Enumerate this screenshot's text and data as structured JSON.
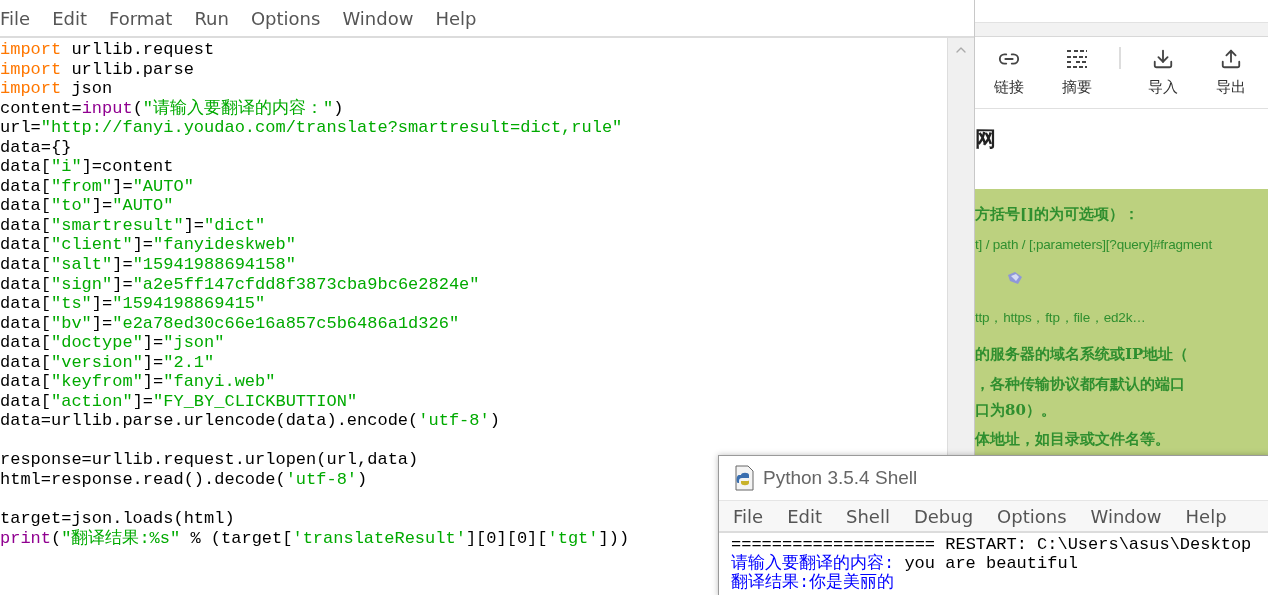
{
  "editor": {
    "menu": [
      "File",
      "Edit",
      "Format",
      "Run",
      "Options",
      "Window",
      "Help"
    ],
    "blocks": [
      [
        [
          {
            "kind": "keyword",
            "text": "import"
          },
          {
            "kind": "plain",
            "text": " urllib.request"
          }
        ],
        [
          {
            "kind": "keyword",
            "text": "import"
          },
          {
            "kind": "plain",
            "text": " urllib.parse"
          }
        ],
        [
          {
            "kind": "keyword",
            "text": "import"
          },
          {
            "kind": "plain",
            "text": " json"
          }
        ],
        [
          {
            "kind": "plain",
            "text": "content="
          },
          {
            "kind": "builtin",
            "text": "input"
          },
          {
            "kind": "plain",
            "text": "("
          },
          {
            "kind": "string",
            "text": "\"请输入要翻译的内容：\""
          },
          {
            "kind": "plain",
            "text": ")"
          }
        ],
        [
          {
            "kind": "plain",
            "text": "url="
          },
          {
            "kind": "string",
            "text": "\"http://fanyi.youdao.com/translate?smartresult=dict,rule\""
          }
        ],
        [
          {
            "kind": "plain",
            "text": "data={}"
          }
        ],
        [
          {
            "kind": "plain",
            "text": "data["
          },
          {
            "kind": "string",
            "text": "\"i\""
          },
          {
            "kind": "plain",
            "text": "]=content"
          }
        ],
        [
          {
            "kind": "plain",
            "text": "data["
          },
          {
            "kind": "string",
            "text": "\"from\""
          },
          {
            "kind": "plain",
            "text": "]="
          },
          {
            "kind": "string",
            "text": "\"AUTO\""
          }
        ],
        [
          {
            "kind": "plain",
            "text": "data["
          },
          {
            "kind": "string",
            "text": "\"to\""
          },
          {
            "kind": "plain",
            "text": "]="
          },
          {
            "kind": "string",
            "text": "\"AUTO\""
          }
        ],
        [
          {
            "kind": "plain",
            "text": "data["
          },
          {
            "kind": "string",
            "text": "\"smartresult\""
          },
          {
            "kind": "plain",
            "text": "]="
          },
          {
            "kind": "string",
            "text": "\"dict\""
          }
        ],
        [
          {
            "kind": "plain",
            "text": "data["
          },
          {
            "kind": "string",
            "text": "\"client\""
          },
          {
            "kind": "plain",
            "text": "]="
          },
          {
            "kind": "string",
            "text": "\"fanyideskweb\""
          }
        ],
        [
          {
            "kind": "plain",
            "text": "data["
          },
          {
            "kind": "string",
            "text": "\"salt\""
          },
          {
            "kind": "plain",
            "text": "]="
          },
          {
            "kind": "string",
            "text": "\"15941988694158\""
          }
        ],
        [
          {
            "kind": "plain",
            "text": "data["
          },
          {
            "kind": "string",
            "text": "\"sign\""
          },
          {
            "kind": "plain",
            "text": "]="
          },
          {
            "kind": "string",
            "text": "\"a2e5ff147cfdd8f3873cba9bc6e2824e\""
          }
        ],
        [
          {
            "kind": "plain",
            "text": "data["
          },
          {
            "kind": "string",
            "text": "\"ts\""
          },
          {
            "kind": "plain",
            "text": "]="
          },
          {
            "kind": "string",
            "text": "\"1594198869415\""
          }
        ],
        [
          {
            "kind": "plain",
            "text": "data["
          },
          {
            "kind": "string",
            "text": "\"bv\""
          },
          {
            "kind": "plain",
            "text": "]="
          },
          {
            "kind": "string",
            "text": "\"e2a78ed30c66e16a857c5b6486a1d326\""
          }
        ],
        [
          {
            "kind": "plain",
            "text": "data["
          },
          {
            "kind": "string",
            "text": "\"doctype\""
          },
          {
            "kind": "plain",
            "text": "]="
          },
          {
            "kind": "string",
            "text": "\"json\""
          }
        ],
        [
          {
            "kind": "plain",
            "text": "data["
          },
          {
            "kind": "string",
            "text": "\"version\""
          },
          {
            "kind": "plain",
            "text": "]="
          },
          {
            "kind": "string",
            "text": "\"2.1\""
          }
        ],
        [
          {
            "kind": "plain",
            "text": "data["
          },
          {
            "kind": "string",
            "text": "\"keyfrom\""
          },
          {
            "kind": "plain",
            "text": "]="
          },
          {
            "kind": "string",
            "text": "\"fanyi.web\""
          }
        ],
        [
          {
            "kind": "plain",
            "text": "data["
          },
          {
            "kind": "string",
            "text": "\"action\""
          },
          {
            "kind": "plain",
            "text": "]="
          },
          {
            "kind": "string",
            "text": "\"FY_BY_CLICKBUTTION\""
          }
        ],
        [
          {
            "kind": "plain",
            "text": "data=urllib.parse.urlencode(data).encode("
          },
          {
            "kind": "string",
            "text": "'utf-8'"
          },
          {
            "kind": "plain",
            "text": ")"
          }
        ]
      ],
      [
        [
          {
            "kind": "plain",
            "text": "response=urllib.request.urlopen(url,data)"
          }
        ],
        [
          {
            "kind": "plain",
            "text": "html=response.read().decode("
          },
          {
            "kind": "string",
            "text": "'utf-8'"
          },
          {
            "kind": "plain",
            "text": ")"
          }
        ]
      ],
      [
        [
          {
            "kind": "plain",
            "text": "target=json.loads(html)"
          }
        ],
        [
          {
            "kind": "builtin",
            "text": "print"
          },
          {
            "kind": "plain",
            "text": "("
          },
          {
            "kind": "string",
            "text": "\"翻译结果:%s\""
          },
          {
            "kind": "plain",
            "text": " % (target["
          },
          {
            "kind": "string",
            "text": "'translateResult'"
          },
          {
            "kind": "plain",
            "text": "][0][0]["
          },
          {
            "kind": "string",
            "text": "'tgt'"
          },
          {
            "kind": "plain",
            "text": "]))"
          }
        ]
      ]
    ]
  },
  "background_page": {
    "toolbar": [
      {
        "kind": "link",
        "label": "链接"
      },
      {
        "kind": "summary",
        "label": "摘要"
      },
      {
        "kind": "divider"
      },
      {
        "kind": "import",
        "label": "导入"
      },
      {
        "kind": "export",
        "label": "导出"
      }
    ],
    "heading": "网",
    "image_lines": [
      {
        "kind": "text",
        "text": "方括号[]的为可选项）："
      },
      {
        "kind": "latin",
        "text": "t] / path / [;parameters][?query]#fragment"
      },
      {
        "kind": "clipart"
      },
      {
        "kind": "latin",
        "text": "ttp，https，ftp，file，ed2k…"
      },
      {
        "kind": "text",
        "text": "的服务器的域名系统或IP地址（"
      },
      {
        "kind": "text",
        "text": "，各种传输协议都有默认的端口"
      },
      {
        "kind": "text",
        "text": "口为80）。"
      },
      {
        "kind": "text",
        "text": "体地址，如目录或文件名等。"
      }
    ]
  },
  "shell": {
    "title": "Python 3.5.4 Shell",
    "menu": [
      "File",
      "Edit",
      "Shell",
      "Debug",
      "Options",
      "Window",
      "Help"
    ],
    "lines": [
      [
        {
          "kind": "plain",
          "text": "==================== RESTART: C:\\Users\\asus\\Desktop"
        }
      ],
      [
        {
          "kind": "output",
          "text": "请输入要翻译的内容:"
        },
        {
          "kind": "plain",
          "text": " you are beautiful"
        }
      ],
      [
        {
          "kind": "output",
          "text": "翻译结果:你是美丽的"
        }
      ]
    ]
  }
}
